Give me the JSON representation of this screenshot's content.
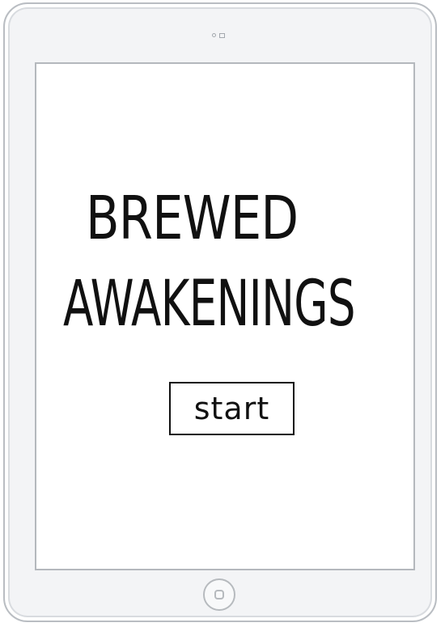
{
  "app": {
    "title_line_1": "BREWED",
    "title_line_2": "AWAKENINGS"
  },
  "start_button": {
    "label": "start"
  },
  "device": {
    "frame_color": "#f3f4f6",
    "border_color": "#b9bdc2",
    "screen_color": "#ffffff",
    "ink_color": "#111111",
    "icons": [
      "front-camera-icon",
      "sensor-icon",
      "home-button-icon"
    ]
  }
}
